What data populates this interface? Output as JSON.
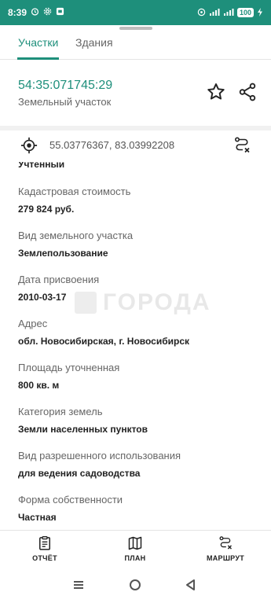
{
  "status_bar": {
    "time": "8:39",
    "battery": "100"
  },
  "tabs": [
    {
      "label": "Участки",
      "active": true
    },
    {
      "label": "Здания",
      "active": false
    }
  ],
  "parcel": {
    "cadastral_number": "54:35:071745:29",
    "type": "Земельный участок"
  },
  "coordinates": "55.03776367, 83.03992208",
  "partial_value": "Учтенный",
  "fields": [
    {
      "label": "Кадастровая стоимость",
      "value": "279 824 руб."
    },
    {
      "label": "Вид земельного участка",
      "value": "Землепользование"
    },
    {
      "label": "Дата присвоения",
      "value": "2010-03-17"
    },
    {
      "label": "Адрес",
      "value": "обл. Новосибирская, г. Новосибирск"
    },
    {
      "label": "Площадь уточненная",
      "value": "800 кв. м"
    },
    {
      "label": "Категория земель",
      "value": "Земли населенных пунктов"
    },
    {
      "label": "Вид разрешенного использования",
      "value": "для ведения садоводства"
    },
    {
      "label": "Форма собственности",
      "value": "Частная"
    }
  ],
  "watermark": "ГОРОДА",
  "bottom_actions": [
    {
      "label": "ОТЧЁТ",
      "icon": "report-icon"
    },
    {
      "label": "ПЛАН",
      "icon": "map-icon"
    },
    {
      "label": "МАРШРУТ",
      "icon": "route-icon"
    }
  ],
  "colors": {
    "accent": "#1e8f7b",
    "status_bar": "#1e8f7b",
    "text": "#222222",
    "muted": "#666666"
  }
}
